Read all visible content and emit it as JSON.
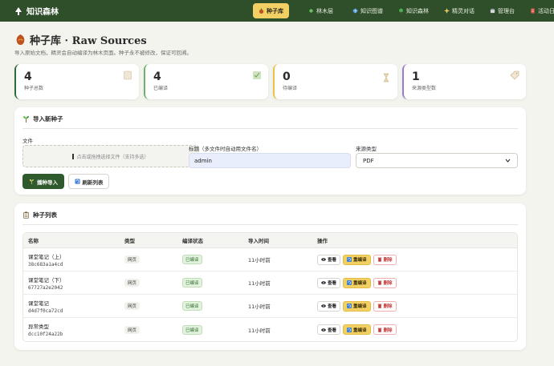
{
  "brand": {
    "name": "知识森林"
  },
  "nav": [
    {
      "label": "种子库",
      "icon": "seed-icon",
      "active": true
    },
    {
      "label": "林木层",
      "icon": "dot-icon"
    },
    {
      "label": "知识图谱",
      "icon": "globe-icon"
    },
    {
      "label": "知识森林",
      "icon": "tree-icon"
    },
    {
      "label": "精灵对话",
      "icon": "sparkle-icon"
    },
    {
      "label": "管理台",
      "icon": "gear-icon"
    },
    {
      "label": "活动日志",
      "icon": "log-icon"
    }
  ],
  "page": {
    "title": "种子库 · Raw Sources",
    "subtitle": "导入原始文档，精灵会自动编译为林木页面。种子永不被修改，保证可回溯。"
  },
  "stats": [
    {
      "value": "4",
      "label": "种子总数",
      "icon": "document-icon",
      "accent": "#2f6b36"
    },
    {
      "value": "4",
      "label": "已编译",
      "icon": "check-box-icon",
      "accent": "#6cb36b"
    },
    {
      "value": "0",
      "label": "待编译",
      "icon": "hourglass-icon",
      "accent": "#e9c44a"
    },
    {
      "value": "1",
      "label": "来源类型数",
      "icon": "tag-icon",
      "accent": "#9b7ad1"
    }
  ],
  "import": {
    "title": "导入新种子",
    "file_label": "文件",
    "dropzone_text": "点击或拖拽选择文件（支持多选）",
    "title_label": "标题（多文件时自动用文件名）",
    "title_value": "admin",
    "type_label": "来源类型",
    "type_value": "PDF",
    "plant_button": "播种导入",
    "refresh_button": "刷新列表"
  },
  "seed_list": {
    "title": "种子列表",
    "columns": [
      "名称",
      "类型",
      "编译状态",
      "导入时间",
      "操作"
    ],
    "rows": [
      {
        "name": "课堂笔记（上）",
        "id": "38c683a1a4cd",
        "type": "网页",
        "status": "已编译",
        "time": "11小时前"
      },
      {
        "name": "课堂笔记（下）",
        "id": "67727a2e2042",
        "type": "网页",
        "status": "已编译",
        "time": "11小时前"
      },
      {
        "name": "课堂笔记",
        "id": "d4d7f0ca72cd",
        "type": "网页",
        "status": "已编译",
        "time": "11小时前"
      },
      {
        "name": "异常类型",
        "id": "dcc10f24a22b",
        "type": "网页",
        "status": "已编译",
        "time": "11小时前"
      }
    ],
    "actions": {
      "view": "查看",
      "recompile": "重编译",
      "delete": "删除"
    }
  },
  "colors": {
    "topbar": "#2f4f2b",
    "accent": "#f3d064",
    "primary": "#2f5a2d"
  }
}
